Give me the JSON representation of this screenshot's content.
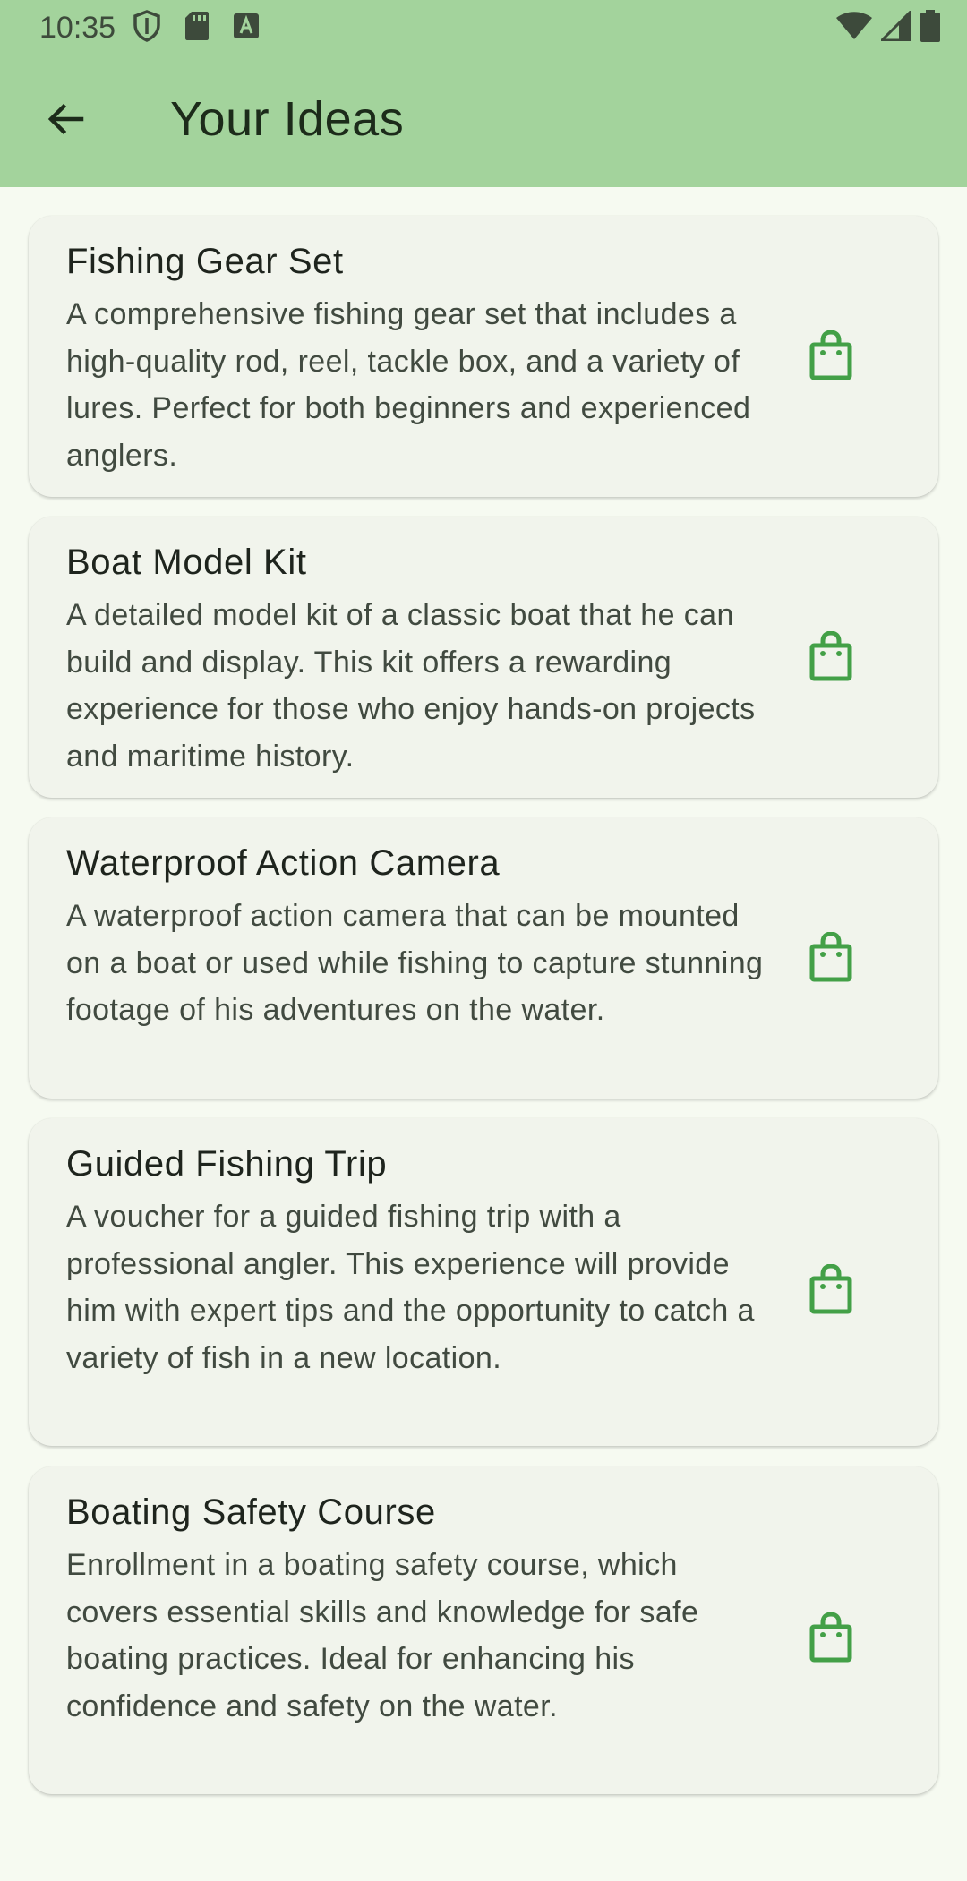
{
  "status_bar": {
    "time": "10:35",
    "left_icons": [
      "shield-icon",
      "sd-card-icon",
      "text-a-icon"
    ],
    "right_icons": [
      "wifi-icon",
      "cell-signal-icon",
      "battery-icon"
    ]
  },
  "app_bar": {
    "title": "Your Ideas",
    "back_icon": "arrow-back-icon",
    "background_color": "#a3d39c"
  },
  "ideas": [
    {
      "title": "Fishing Gear Set",
      "description": "A comprehensive fishing gear set that includes a high-quality rod, reel, tackle box, and a variety of lures. Perfect for both beginners and experienced anglers.",
      "action_icon": "shopping-bag-icon"
    },
    {
      "title": "Boat Model Kit",
      "description": "A detailed model kit of a classic boat that he can build and display. This kit offers a rewarding experience for those who enjoy hands-on projects and maritime history.",
      "action_icon": "shopping-bag-icon"
    },
    {
      "title": "Waterproof Action Camera",
      "description": "A waterproof action camera that can be mounted on a boat or used while fishing to capture stunning footage of his adventures on the water.",
      "action_icon": "shopping-bag-icon"
    },
    {
      "title": "Guided Fishing Trip",
      "description": "A voucher for a guided fishing trip with a professional angler. This experience will provide him with expert tips and the opportunity to catch a variety of fish in a new location.",
      "action_icon": "shopping-bag-icon"
    },
    {
      "title": "Boating Safety Course",
      "description": "Enrollment in a boating safety course, which covers essential skills and knowledge for safe boating practices. Ideal for enhancing his confidence and safety on the water.",
      "action_icon": "shopping-bag-icon"
    }
  ],
  "colors": {
    "accent": "#43a047",
    "page_background": "#f6faf1",
    "card_background": "#f1f4ec"
  }
}
